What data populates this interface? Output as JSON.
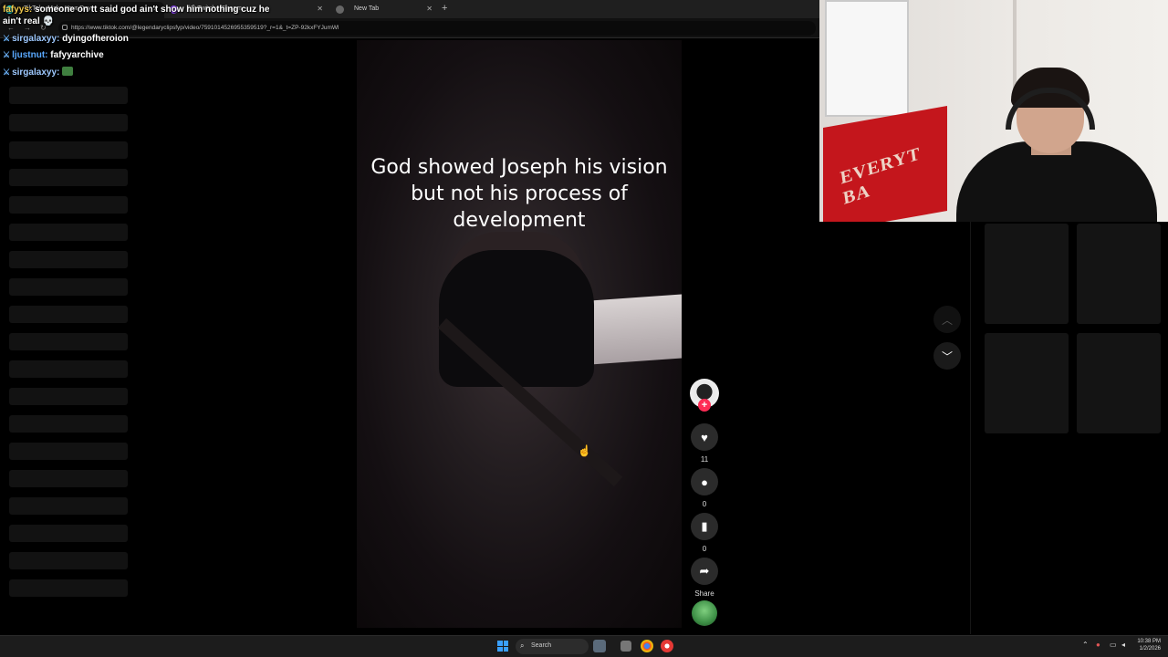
{
  "browser": {
    "tabs": [
      {
        "label": "TikTok - Make Your Day"
      },
      {
        "label": "(1) Twitch - Stream"
      },
      {
        "label": "New Tab"
      }
    ],
    "new_tab_icon": "plus-icon",
    "url": "https://www.tiktok.com/@legendaryclipsfyp/video/7591014526955359519?_r=1&_t=ZP-92kxFYJumWl"
  },
  "chat": {
    "top_message": {
      "user": "fafyys:",
      "text": "someone on tt said god ain't show him nothing cuz he ain't real 💀"
    },
    "lines": [
      {
        "user": "sirgalaxyy:",
        "text": "dyingofheroion"
      },
      {
        "user": "ljustnut:",
        "text": "fafyyarchive"
      },
      {
        "user": "sirgalaxyy:",
        "text": ""
      }
    ]
  },
  "video": {
    "caption": "God showed Joseph his vision but not his process of development"
  },
  "actions": {
    "like_count": "11",
    "comment_count": "0",
    "save_count": "0",
    "share_label": "Share"
  },
  "webcam": {
    "flag_text": "EVERYT BA"
  },
  "taskbar": {
    "search_placeholder": "Search",
    "time": "10:38 PM",
    "date": "1/2/2026"
  },
  "colors": {
    "accent": "#fe2c55",
    "background": "#000000",
    "chat_user": "#9ec9ff"
  }
}
